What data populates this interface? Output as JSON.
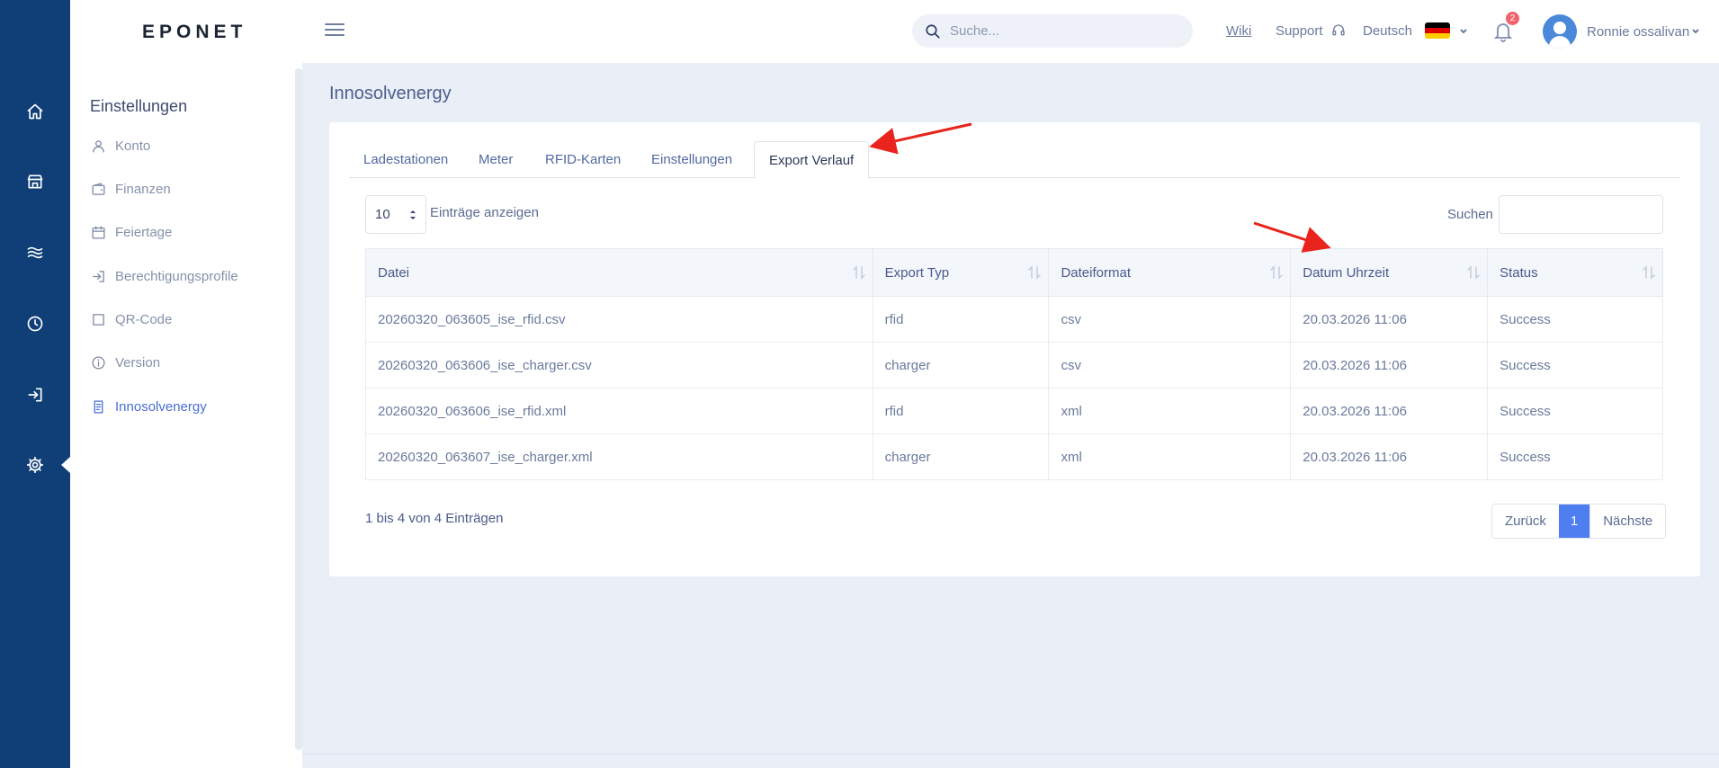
{
  "header": {
    "logo": "EPONET",
    "search_placeholder": "Suche...",
    "wiki": "Wiki",
    "support": "Support",
    "language": "Deutsch",
    "notification_count": "2",
    "user_name": "Ronnie ossalivan"
  },
  "rail": {
    "icons": [
      "home-icon",
      "store-icon",
      "waves-icon",
      "clock-icon",
      "login-icon",
      "gear-icon"
    ],
    "active": "gear-icon"
  },
  "sidebar": {
    "title": "Einstellungen",
    "items": [
      {
        "label": "Konto",
        "icon": "user-icon"
      },
      {
        "label": "Finanzen",
        "icon": "wallet-icon"
      },
      {
        "label": "Feiertage",
        "icon": "calendar-icon"
      },
      {
        "label": "Berechtigungsprofile",
        "icon": "enter-icon"
      },
      {
        "label": "QR-Code",
        "icon": "square-icon"
      },
      {
        "label": "Version",
        "icon": "info-icon"
      },
      {
        "label": "Innosolvenergy",
        "icon": "document-icon",
        "active": true
      }
    ]
  },
  "main": {
    "page_title": "Innosolvenergy",
    "tabs": [
      "Ladestationen",
      "Meter",
      "RFID-Karten",
      "Einstellungen",
      "Export Verlauf"
    ],
    "active_tab": "Export Verlauf",
    "length_value": "10",
    "length_label": "Einträge anzeigen",
    "filter_label": "Suchen",
    "columns": [
      "Datei",
      "Export Typ",
      "Dateiformat",
      "Datum Uhrzeit",
      "Status"
    ],
    "rows": [
      [
        "20260320_063605_ise_rfid.csv",
        "rfid",
        "csv",
        "20.03.2026 11:06",
        "Success"
      ],
      [
        "20260320_063606_ise_charger.csv",
        "charger",
        "csv",
        "20.03.2026 11:06",
        "Success"
      ],
      [
        "20260320_063606_ise_rfid.xml",
        "rfid",
        "xml",
        "20.03.2026 11:06",
        "Success"
      ],
      [
        "20260320_063607_ise_charger.xml",
        "charger",
        "xml",
        "20.03.2026 11:06",
        "Success"
      ]
    ],
    "info": "1 bis 4 von 4 Einträgen",
    "pager": {
      "prev": "Zurück",
      "current": "1",
      "next": "Nächste"
    }
  },
  "colors": {
    "rail_bg": "#0f3f76",
    "accent": "#4f7ef0",
    "annotation_arrow": "#e8241c"
  }
}
